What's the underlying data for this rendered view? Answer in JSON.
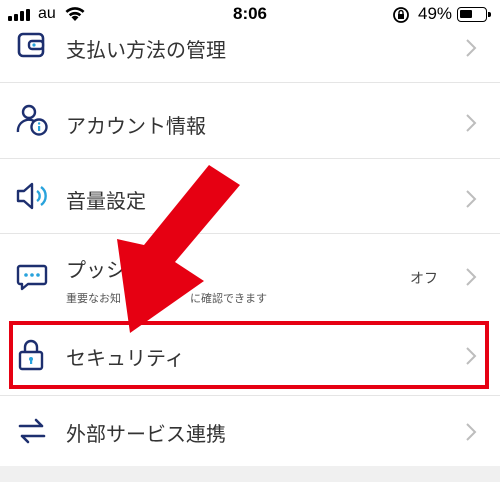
{
  "status_bar": {
    "carrier": "au",
    "time": "8:06",
    "battery": "49%",
    "battery_level": 0.49
  },
  "menu": {
    "payment": {
      "label": "支払い方法の管理"
    },
    "account": {
      "label": "アカウント情報"
    },
    "volume": {
      "label": "音量設定"
    },
    "push": {
      "label": "プッシュ",
      "sub": "重要なお知",
      "sub_tail": "に確認できます",
      "value": "オフ"
    },
    "security": {
      "label": "セキュリティ"
    },
    "external": {
      "label": "外部サービス連携"
    }
  },
  "colors": {
    "icon_navy": "#1d2f6f",
    "icon_accent": "#29a3dc",
    "highlight_red": "#e60012",
    "chevron": "#bdbdbd"
  },
  "icons": [
    "wallet-icon",
    "user-info-icon",
    "speaker-icon",
    "chat-icon",
    "lock-icon",
    "arrows-exchange-icon",
    "chevron-right-icon"
  ]
}
